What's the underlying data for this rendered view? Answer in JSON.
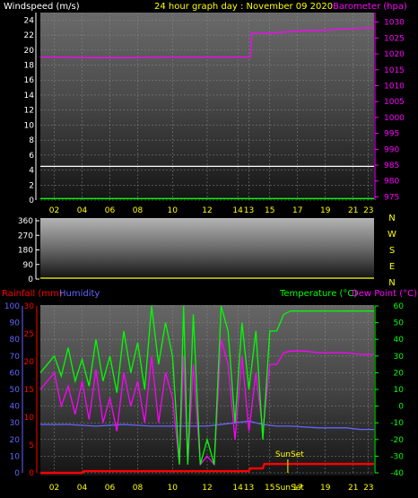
{
  "header": {
    "windspeed_label": "Windspeed (m/s)",
    "title": "24 hour graph day : November 09 2020",
    "barometer_label": "Barometer (hpa)"
  },
  "lower_header": {
    "rainfall_label": "Rainfall (mm)",
    "humidity_label": "Humidity",
    "temperature_label": "Temperature (°C)",
    "dewpoint_label": "Dew Point (°C)"
  },
  "sunset_label": "SunSet",
  "sunset_hour": 17.8,
  "colors": {
    "windspeed": "#ffffff",
    "title": "#ffff00",
    "barometer": "#ff00ff",
    "rainfall": "#ff0000",
    "humidity": "#6464ff",
    "temperature": "#00ff00",
    "dewpoint": "#ff00ff",
    "time_labels": "#ffff00",
    "direction_letters": "#ffff00"
  },
  "chart_data": [
    {
      "type": "line",
      "xlabel": "",
      "x_ticks": [
        "02",
        "04",
        "06",
        "08",
        "10",
        "12",
        "14",
        "13",
        "15",
        "17",
        "19",
        "21",
        "23"
      ],
      "y_left": {
        "label": "Windspeed (m/s)",
        "ticks": [
          "0",
          "2",
          "4",
          "6",
          "8",
          "10",
          "12",
          "14",
          "16",
          "18",
          "20",
          "22",
          "24"
        ],
        "lim": [
          0,
          25
        ]
      },
      "y_right": {
        "label": "Barometer (hpa)",
        "ticks": [
          "975",
          "980",
          "985",
          "990",
          "995",
          "1000",
          "1005",
          "1010",
          "1015",
          "1020",
          "1025",
          "1030"
        ],
        "lim": [
          974,
          1033
        ]
      },
      "series": [
        {
          "name": "Barometer (hpa)",
          "axis": "right",
          "x": [
            0,
            2,
            4,
            6,
            8,
            10,
            12,
            14,
            15.1,
            15.2,
            16,
            17,
            18,
            19,
            20,
            21,
            22,
            23,
            24
          ],
          "values": [
            1019,
            1018.9,
            1018.8,
            1018.8,
            1018.9,
            1019,
            1019,
            1019,
            1019,
            1026.5,
            1026.4,
            1026.7,
            1027,
            1027.3,
            1027.4,
            1027.6,
            1027.9,
            1028.1,
            1028.2
          ]
        },
        {
          "name": "Windspeed (m/s)",
          "axis": "left",
          "x": [
            0,
            24
          ],
          "values": [
            4.5,
            4.5
          ]
        },
        {
          "name": "Windspeed gust",
          "axis": "left",
          "x": [
            0,
            24
          ],
          "values": [
            0.2,
            0.2
          ]
        }
      ]
    },
    {
      "type": "line",
      "y_ticks": [
        "0",
        "90",
        "180",
        "270",
        "360"
      ],
      "ylim": [
        0,
        360
      ],
      "direction_letters": [
        "N",
        "W",
        "S",
        "E",
        "N"
      ]
    },
    {
      "type": "line",
      "x_ticks": [
        "02",
        "04",
        "06",
        "08",
        "10",
        "12",
        "14",
        "13",
        "15",
        "17",
        "19",
        "21",
        "23"
      ],
      "y_humidity": {
        "ticks": [
          "0",
          "10",
          "20",
          "30",
          "40",
          "50",
          "60",
          "70",
          "80",
          "90",
          "100"
        ],
        "lim": [
          0,
          100
        ]
      },
      "y_rainfall": {
        "ticks": [
          "0",
          "5",
          "10",
          "15",
          "20",
          "25",
          "30"
        ],
        "lim": [
          0,
          30
        ]
      },
      "y_temperature": {
        "ticks": [
          "-40",
          "-30",
          "-20",
          "-10",
          "0",
          "10",
          "20",
          "30",
          "40",
          "50",
          "60"
        ],
        "lim": [
          -40,
          60
        ]
      },
      "series": [
        {
          "name": "Temperature (°C)",
          "axis": "temperature",
          "x": [
            0,
            1,
            1.5,
            2,
            2.5,
            3,
            3.5,
            4,
            4.5,
            5,
            5.5,
            6,
            6.5,
            7,
            7.5,
            8,
            8.5,
            9,
            9.5,
            10,
            10.3,
            10.6,
            11,
            11.5,
            12,
            12.5,
            13,
            13.5,
            14,
            14.5,
            15,
            15.5,
            16,
            16.5,
            17,
            17.5,
            18,
            19,
            20,
            21,
            22,
            23,
            24
          ],
          "values": [
            20,
            30,
            18,
            35,
            15,
            28,
            12,
            40,
            15,
            30,
            8,
            45,
            20,
            38,
            10,
            60,
            25,
            50,
            30,
            -35,
            60,
            -35,
            55,
            -35,
            -20,
            -35,
            60,
            45,
            -10,
            50,
            10,
            45,
            -20,
            45,
            45,
            55,
            57,
            57,
            57,
            57,
            57,
            57,
            57
          ]
        },
        {
          "name": "Dew Point (°C)",
          "axis": "temperature",
          "x": [
            0,
            1,
            1.5,
            2,
            2.5,
            3,
            3.5,
            4,
            4.5,
            5,
            5.5,
            6,
            6.5,
            7,
            7.5,
            8,
            8.5,
            9,
            9.5,
            10,
            10.3,
            10.6,
            11,
            11.5,
            12,
            12.5,
            13,
            13.5,
            14,
            14.5,
            15,
            15.5,
            16,
            16.5,
            17,
            17.5,
            18,
            19,
            20,
            21,
            22,
            23,
            24
          ],
          "values": [
            10,
            20,
            0,
            12,
            -5,
            15,
            -8,
            22,
            -10,
            5,
            -15,
            20,
            0,
            15,
            -10,
            30,
            -10,
            20,
            5,
            -35,
            30,
            -35,
            25,
            -35,
            -30,
            -35,
            40,
            25,
            -20,
            30,
            -15,
            20,
            -15,
            25,
            25,
            32,
            33,
            33,
            32,
            32,
            32,
            31,
            31
          ]
        },
        {
          "name": "Humidity",
          "axis": "humidity",
          "x": [
            0,
            2,
            4,
            6,
            8,
            10,
            12,
            14,
            15,
            16,
            17,
            18,
            20,
            22,
            23,
            24
          ],
          "values": [
            29,
            29,
            28,
            29,
            28,
            28,
            28,
            30,
            31,
            29,
            28,
            28,
            27,
            27,
            26,
            26
          ]
        },
        {
          "name": "Rainfall (mm)",
          "axis": "rainfall",
          "x": [
            0,
            3,
            3.1,
            15,
            15.1,
            16,
            16.1,
            24
          ],
          "values": [
            0,
            0,
            0.3,
            0.3,
            0.8,
            0.8,
            1.6,
            1.6
          ]
        }
      ]
    }
  ]
}
